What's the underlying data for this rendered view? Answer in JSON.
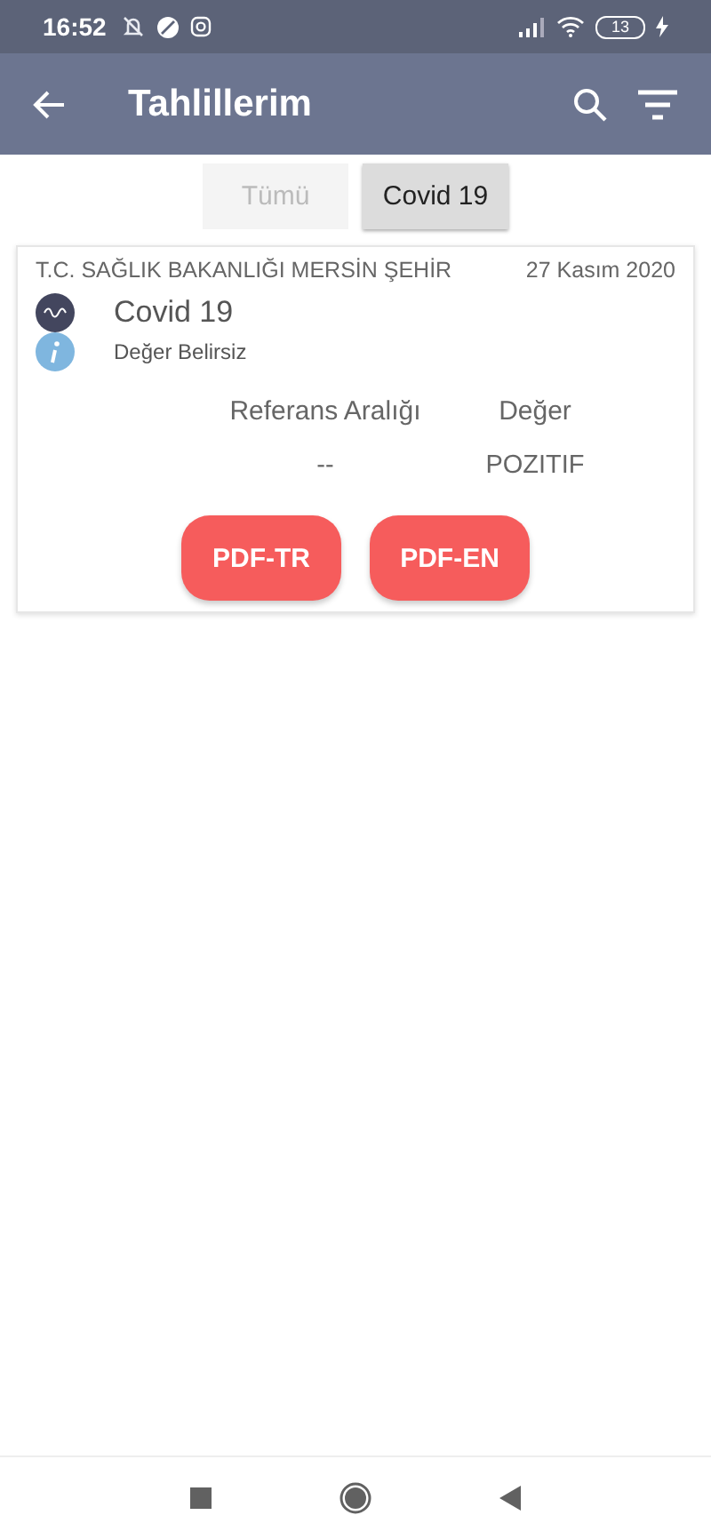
{
  "status_bar": {
    "time": "16:52",
    "battery": "13"
  },
  "app_bar": {
    "title": "Tahlillerim"
  },
  "tabs": [
    {
      "label": "Tümü",
      "selected": false
    },
    {
      "label": "Covid 19",
      "selected": true
    }
  ],
  "results": [
    {
      "lab": "T.C. SAĞLIK BAKANLIĞI MERSİN ŞEHİR",
      "date": "27 Kasım 2020",
      "test": "Covid 19",
      "note": "Değer Belirsiz",
      "headers": [
        "Referans Aralığı",
        "Değer"
      ],
      "values": [
        "--",
        "POZITIF"
      ],
      "buttons": [
        "PDF-TR",
        "PDF-EN"
      ]
    }
  ]
}
